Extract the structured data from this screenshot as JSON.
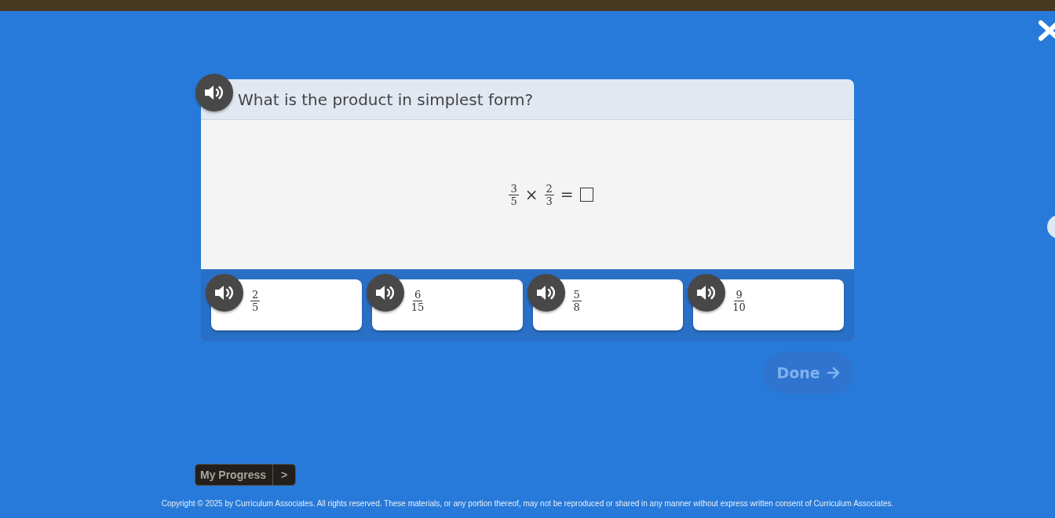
{
  "question": {
    "prompt": "What is the product in simplest form?",
    "equation": [
      {
        "kind": "fraction",
        "numerator": "3",
        "denominator": "5"
      },
      {
        "kind": "symbol",
        "text": "×"
      },
      {
        "kind": "fraction",
        "numerator": "2",
        "denominator": "3"
      },
      {
        "kind": "symbol",
        "text": "="
      },
      {
        "kind": "blank"
      }
    ]
  },
  "answers": [
    {
      "numerator": "2",
      "denominator": "5",
      "selected": false
    },
    {
      "numerator": "6",
      "denominator": "15",
      "selected": false
    },
    {
      "numerator": "5",
      "denominator": "8",
      "selected": false
    },
    {
      "numerator": "9",
      "denominator": "10",
      "selected": false
    }
  ],
  "done_button": {
    "label": "Done",
    "disabled": true
  },
  "progress_button": {
    "label": "My Progress",
    "arrow": ">"
  },
  "footer": "Copyright © 2025 by Curriculum Associates. All rights reserved. These materials, or any portion thereof, may not be reproduced or shared in any manner without express written consent of Curriculum Associates."
}
